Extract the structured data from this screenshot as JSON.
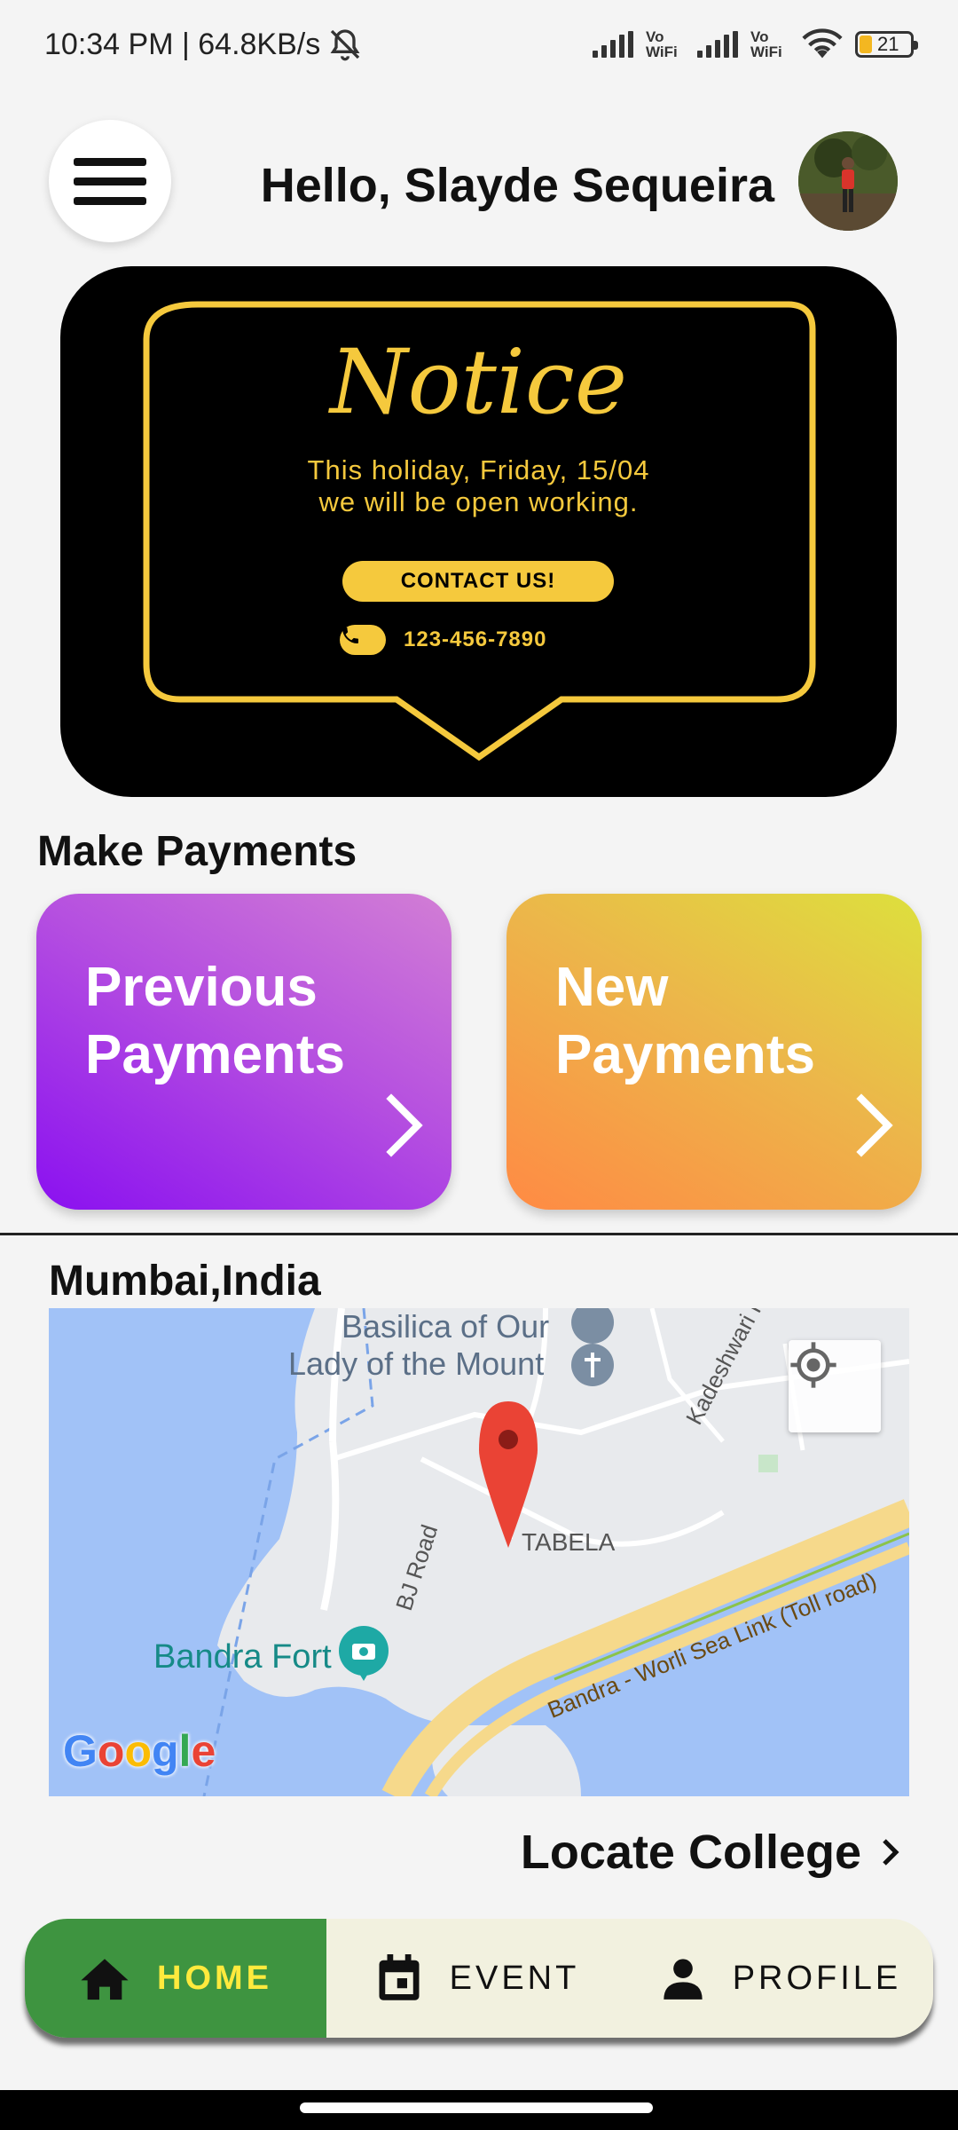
{
  "status_bar": {
    "time_speed": "10:34 PM | 64.8KB/s",
    "vowifi_1": "Vo WiFi",
    "vowifi_2": "Vo WiFi",
    "battery": "21"
  },
  "header": {
    "greeting": "Hello, Slayde Sequeira"
  },
  "notice": {
    "title": "Notice",
    "line1": "This holiday, Friday, 15/04",
    "line2": "we will be open working.",
    "button_label": "CONTACT US!",
    "phone": "123-456-7890",
    "accent_color": "#f5c93d"
  },
  "payments": {
    "section_title": "Make Payments",
    "previous_label": "Previous Payments",
    "new_label": "New Payments"
  },
  "location": {
    "title": "Mumbai,India",
    "map_labels": {
      "basilica_1": "Basilica of Our",
      "basilica_2": "Lady of the Mount",
      "kadeshwari": "Kadeshwari Rd",
      "tabela": "TABELA",
      "bj_road": "BJ Road",
      "bandra_fort": "Bandra Fort",
      "sea_link": "Bandra - Worli Sea Link (Toll road)"
    },
    "locate_label": "Locate College"
  },
  "bottom_nav": {
    "home": "HOME",
    "event": "EVENT",
    "profile": "PROFILE"
  }
}
